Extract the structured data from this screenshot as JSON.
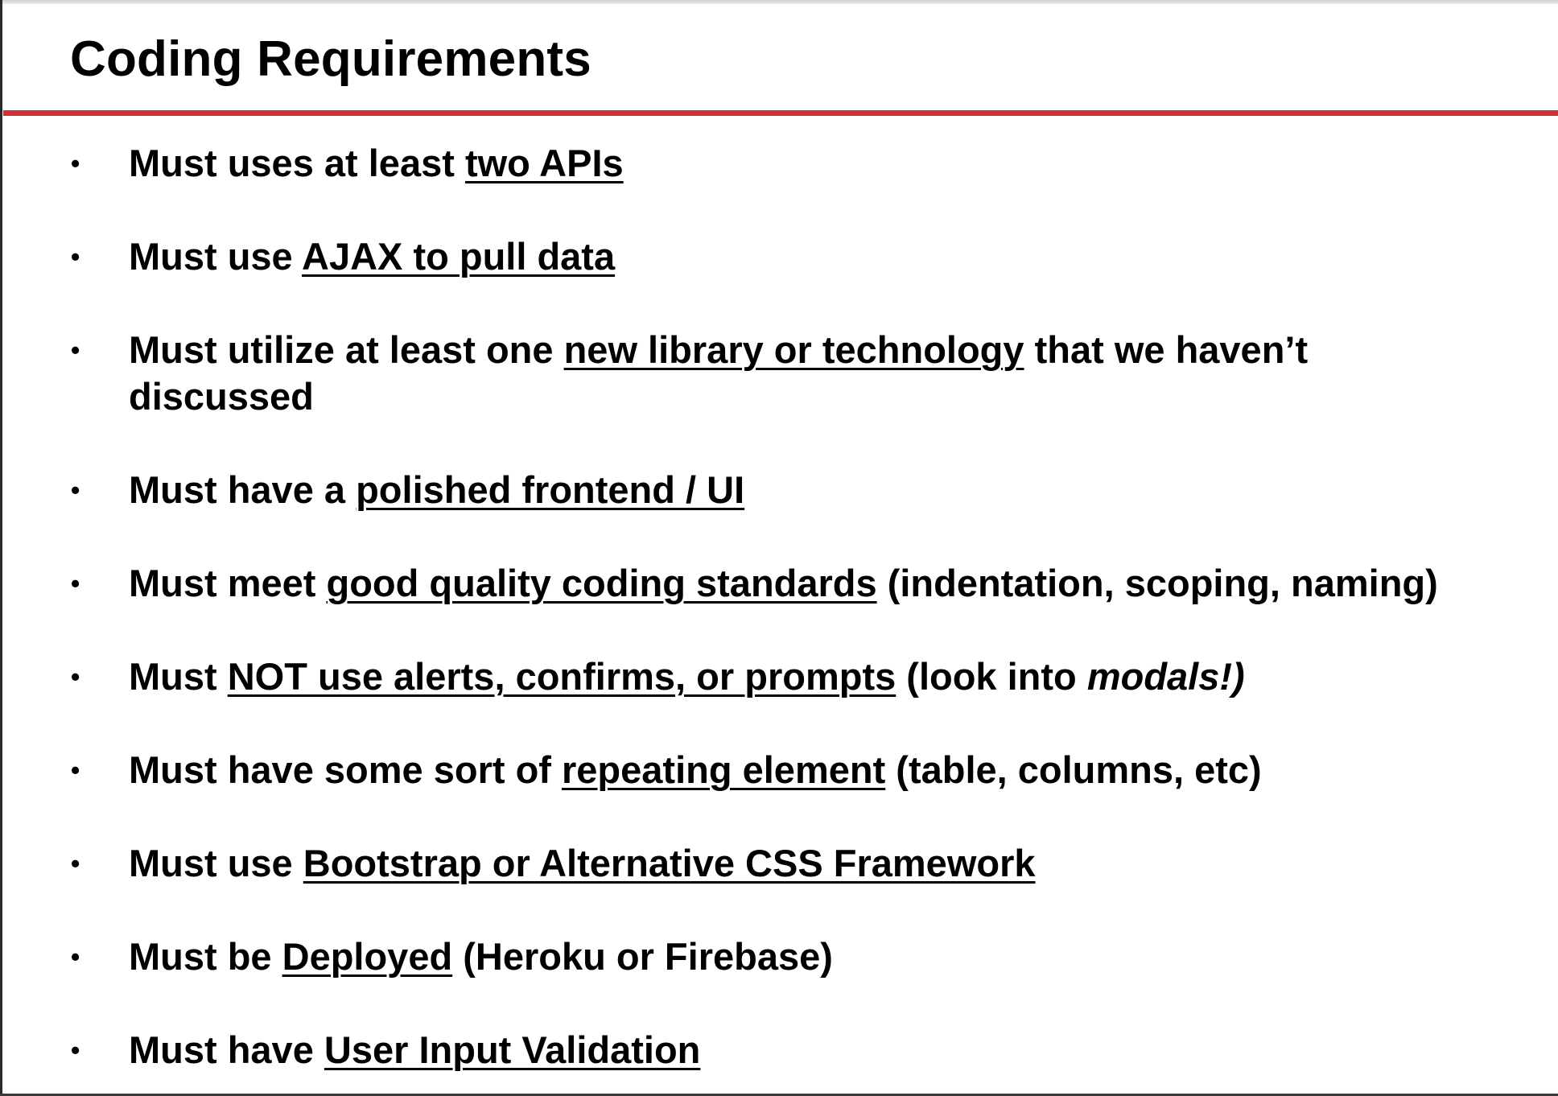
{
  "slide": {
    "title": "Coding Requirements",
    "accent_color": "#cc3333",
    "bullet_symbol": "•",
    "items": [
      {
        "lead": "Must uses at least ",
        "emphasis": "two APIs",
        "tail": ""
      },
      {
        "lead": "Must use ",
        "emphasis": "AJAX to pull data",
        "tail": ""
      },
      {
        "lead": "Must utilize at least one ",
        "emphasis": "new library or technology",
        "tail": " that we haven’t discussed"
      },
      {
        "lead": "Must have a ",
        "emphasis": "polished frontend / UI",
        "tail": ""
      },
      {
        "lead": "Must meet ",
        "emphasis": "good quality coding standards",
        "tail": " (indentation, scoping, naming)"
      },
      {
        "lead": "Must ",
        "emphasis": "NOT use alerts, confirms, or prompts",
        "tail": " (look into ",
        "italic": "modals!)",
        "tail2": ""
      },
      {
        "lead": "Must have some sort of ",
        "emphasis": "repeating element",
        "tail": " (table, columns, etc)"
      },
      {
        "lead": "Must use ",
        "emphasis": "Bootstrap or Alternative CSS Framework",
        "tail": ""
      },
      {
        "lead": "Must be ",
        "emphasis": "Deployed",
        "tail": " (Heroku or Firebase)"
      },
      {
        "lead": "Must have ",
        "emphasis": "User Input Validation",
        "tail": ""
      }
    ]
  }
}
